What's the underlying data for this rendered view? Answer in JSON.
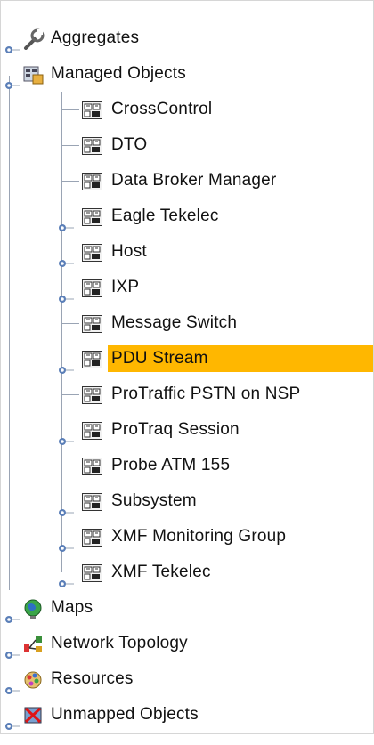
{
  "tree": {
    "top_items": [
      {
        "label": "Aggregates",
        "icon": "wrench-icon",
        "expander": "collapsed"
      },
      {
        "label": "Managed Objects",
        "icon": "managed-objects-icon",
        "expander": "expanded"
      }
    ],
    "managed_children": [
      {
        "label": "CrossControl",
        "icon": "managed-object-icon",
        "expander": "none",
        "selected": false
      },
      {
        "label": "DTO",
        "icon": "managed-object-icon",
        "expander": "none",
        "selected": false
      },
      {
        "label": "Data Broker Manager",
        "icon": "managed-object-icon",
        "expander": "none",
        "selected": false
      },
      {
        "label": "Eagle Tekelec",
        "icon": "managed-object-icon",
        "expander": "collapsed",
        "selected": false
      },
      {
        "label": "Host",
        "icon": "managed-object-icon",
        "expander": "collapsed",
        "selected": false
      },
      {
        "label": "IXP",
        "icon": "managed-object-icon",
        "expander": "collapsed",
        "selected": false
      },
      {
        "label": "Message Switch",
        "icon": "managed-object-icon",
        "expander": "none",
        "selected": false
      },
      {
        "label": "PDU Stream",
        "icon": "managed-object-icon",
        "expander": "collapsed",
        "selected": true
      },
      {
        "label": "ProTraffic PSTN on NSP",
        "icon": "managed-object-icon",
        "expander": "none",
        "selected": false
      },
      {
        "label": "ProTraq Session",
        "icon": "managed-object-icon",
        "expander": "collapsed",
        "selected": false
      },
      {
        "label": "Probe ATM 155",
        "icon": "managed-object-icon",
        "expander": "none",
        "selected": false
      },
      {
        "label": "Subsystem",
        "icon": "managed-object-icon",
        "expander": "collapsed",
        "selected": false
      },
      {
        "label": "XMF Monitoring Group",
        "icon": "managed-object-icon",
        "expander": "collapsed",
        "selected": false
      },
      {
        "label": "XMF Tekelec",
        "icon": "managed-object-icon",
        "expander": "collapsed",
        "selected": false
      }
    ],
    "bottom_items": [
      {
        "label": "Maps",
        "icon": "globe-icon",
        "expander": "collapsed"
      },
      {
        "label": "Network Topology",
        "icon": "network-topology-icon",
        "expander": "collapsed"
      },
      {
        "label": "Resources",
        "icon": "resources-icon",
        "expander": "collapsed"
      },
      {
        "label": "Unmapped Objects",
        "icon": "unmapped-objects-icon",
        "expander": "collapsed"
      }
    ]
  },
  "colors": {
    "selection": "#ffb700",
    "tree_lines": "#9aa4b4",
    "handle": "#5b7fb8"
  }
}
